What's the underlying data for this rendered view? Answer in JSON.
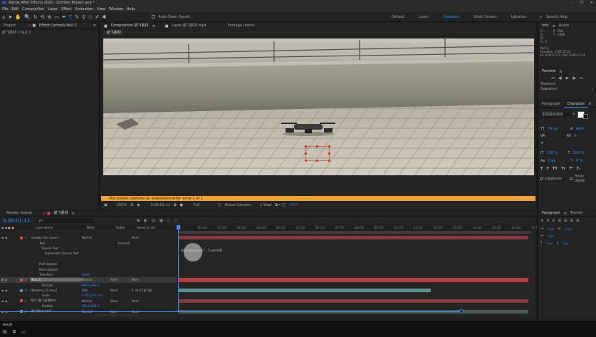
{
  "window": {
    "title": "Adobe After Effects 2020 - Untitled Project.aep *",
    "menu": [
      "File",
      "Edit",
      "Composition",
      "Layer",
      "Effect",
      "Animation",
      "View",
      "Window",
      "Help"
    ],
    "controls": [
      "–",
      "❐",
      "✕"
    ]
  },
  "toolbar": {
    "auto_open_panels": "Auto-Open Panels",
    "workspaces": [
      "Default",
      "Learn",
      "Standard",
      "Small Screen",
      "Libraries"
    ],
    "active_workspace": "Standard",
    "search_placeholder": "Search Help"
  },
  "left_panel": {
    "tab_project": "Project",
    "tab_effects": "Effect Controls Null 2",
    "breadcrumb": "航飞素材 • Null 2"
  },
  "viewer": {
    "tab_comp": "Composition 航飞素材",
    "tab_layer": "Layer 航飞素材.mp4",
    "tab_footage": "Footage (none)",
    "comp_tab": "航飞素材",
    "error_text": "The project contains an expression error: error 1 of 1",
    "zoom": "100%",
    "timecode": "0:00:01:11",
    "resolution": "Full",
    "camera": "Active Camera",
    "view": "1 View",
    "exposure": "+0.0"
  },
  "info_panel": {
    "tab_info": "Info",
    "tab_audio": "Audio",
    "readouts": [
      "R :",
      "G :",
      "B :",
      "A : 0",
      "X : 958",
      "Y : 1086"
    ],
    "layer_name": "Null 2",
    "duration": "Duration: 0:00:16:14",
    "in_out": "In: 0:00:01:11, Out: 0:00:17:24"
  },
  "preview": {
    "title": "Preview",
    "shortcut_label": "Shortcut",
    "shortcut_value": "Spacebar"
  },
  "character": {
    "tab_paragraph_top": "Paragraph",
    "tab_character": "Character",
    "font": "思源黑体简体",
    "size": "74 px",
    "leading": "Auto",
    "tracking": "0",
    "scale_v": "100 %",
    "scale_h": "100 %",
    "baseline": "0 px",
    "tsume": "0 %",
    "ligatures": "Ligatures",
    "hindi_digits": "Hindi Digits"
  },
  "timeline": {
    "tab_render": "Render Queue",
    "tab_comp": "航飞素材",
    "current_time": "0:00:01:11",
    "search_placeholder": "ρ•",
    "columns": {
      "name": "Layer Name",
      "mode": "Mode",
      "trkmat": "TrkMat",
      "parent": "Parent & Link"
    },
    "ruler": [
      "0f",
      "00:15f",
      "01:15f",
      "02:15f",
      "03:15f",
      "04:15f",
      "05:15f",
      "06:15f",
      "07:15f",
      "08:15f",
      "09:15f",
      "10:15f",
      "11:15f",
      "12:15f",
      "13:15f",
      "14:15f",
      "15:15f",
      "16:15f",
      "17:15f"
    ],
    "expression_text": "thisComp.layer(\"...\").point3D",
    "layers": [
      {
        "num": "1",
        "name": "<empty text layer>",
        "mode": "Normal",
        "trkmat": "",
        "parent": "None",
        "color": "#d44d4d",
        "kind": "layer",
        "selected": false
      },
      {
        "num": "",
        "name": "Text",
        "mode": "",
        "trkmat": "",
        "parent": "",
        "color": "",
        "kind": "sub",
        "animate": "Animate:"
      },
      {
        "num": "",
        "name": "Source Text",
        "mode": "",
        "trkmat": "",
        "parent": "",
        "color": "",
        "kind": "sub2"
      },
      {
        "num": "",
        "name": "Expression: Source Text",
        "mode": "",
        "trkmat": "",
        "parent": "",
        "color": "",
        "kind": "sub3"
      },
      {
        "num": "",
        "name": "",
        "mode": "",
        "trkmat": "",
        "parent": "",
        "color": "",
        "kind": "blank"
      },
      {
        "num": "",
        "name": "Path Options",
        "mode": "",
        "trkmat": "",
        "parent": "",
        "color": "",
        "kind": "sub"
      },
      {
        "num": "",
        "name": "More Options",
        "mode": "",
        "trkmat": "",
        "parent": "",
        "color": "",
        "kind": "sub"
      },
      {
        "num": "",
        "name": "Transform",
        "mode": "Reset",
        "trkmat": "",
        "parent": "",
        "color": "",
        "kind": "sub"
      },
      {
        "num": "2",
        "name": "[Null 2]",
        "mode": "Normal",
        "trkmat": "None",
        "parent": "None",
        "color": "#d44d4d",
        "kind": "layer",
        "selected": true
      },
      {
        "num": "",
        "name": "Position",
        "mode": "966.3,464.0",
        "trkmat": "",
        "parent": "",
        "color": "",
        "kind": "prop"
      },
      {
        "num": "3",
        "name": "[Element_11.mov]",
        "mode": "Add",
        "trkmat": "None",
        "parent": "4. Null 1航飞机",
        "color": "#5f8ea3",
        "kind": "layer",
        "selected": false
      },
      {
        "num": "",
        "name": "Scale",
        "mode": "∞ 45.0,45.0 %",
        "trkmat": "",
        "parent": "",
        "color": "",
        "kind": "prop"
      },
      {
        "num": "4",
        "name": "Null 1航飞机跟踪点",
        "mode": "Normal",
        "trkmat": "None",
        "parent": "None",
        "color": "#d44d4d",
        "kind": "layer",
        "selected": false
      },
      {
        "num": "",
        "name": "Position",
        "mode": "966.3,464.0",
        "trkmat": "",
        "parent": "",
        "color": "",
        "kind": "prop"
      },
      {
        "num": "5",
        "name": "[航飞素材.mp4]",
        "mode": "Normal",
        "trkmat": "None",
        "parent": "None",
        "color": "#6b9a8a",
        "kind": "layer",
        "selected": false
      }
    ],
    "footer_left": "Toggle Switches / Modes"
  },
  "paragraph": {
    "tab_paragraph": "Paragraph",
    "tab_tracker": "Tracker"
  },
  "taskbar": {
    "search_text": "avcel",
    "icons": [
      "windows-icon",
      "task-view-icon",
      "chat-icon"
    ]
  }
}
